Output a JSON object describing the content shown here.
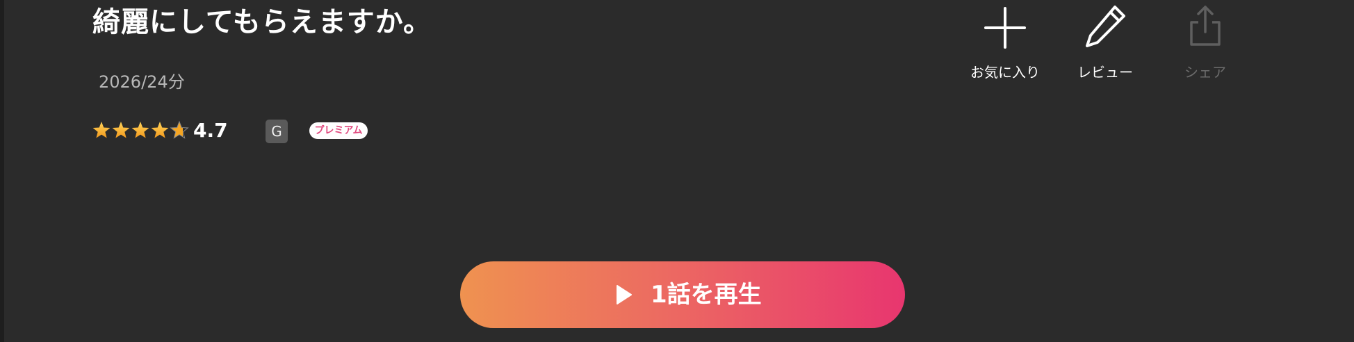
{
  "title": "綺麗にしてもらえますか。",
  "meta": "2026/24分",
  "rating": {
    "value": 4.7,
    "display": "4.7",
    "max": 5,
    "star_color": "#f5a623"
  },
  "badges": {
    "age": "G",
    "premium": "プレミアム"
  },
  "actions": {
    "favorite": {
      "label": "お気に入り",
      "icon": "plus-icon"
    },
    "review": {
      "label": "レビュー",
      "icon": "pencil-icon"
    },
    "share": {
      "label": "シェア",
      "icon": "share-icon",
      "disabled": true
    }
  },
  "play_button": {
    "label": "1話を再生",
    "icon": "play-icon",
    "gradient_start": "#ef9250",
    "gradient_end": "#e8366f"
  }
}
